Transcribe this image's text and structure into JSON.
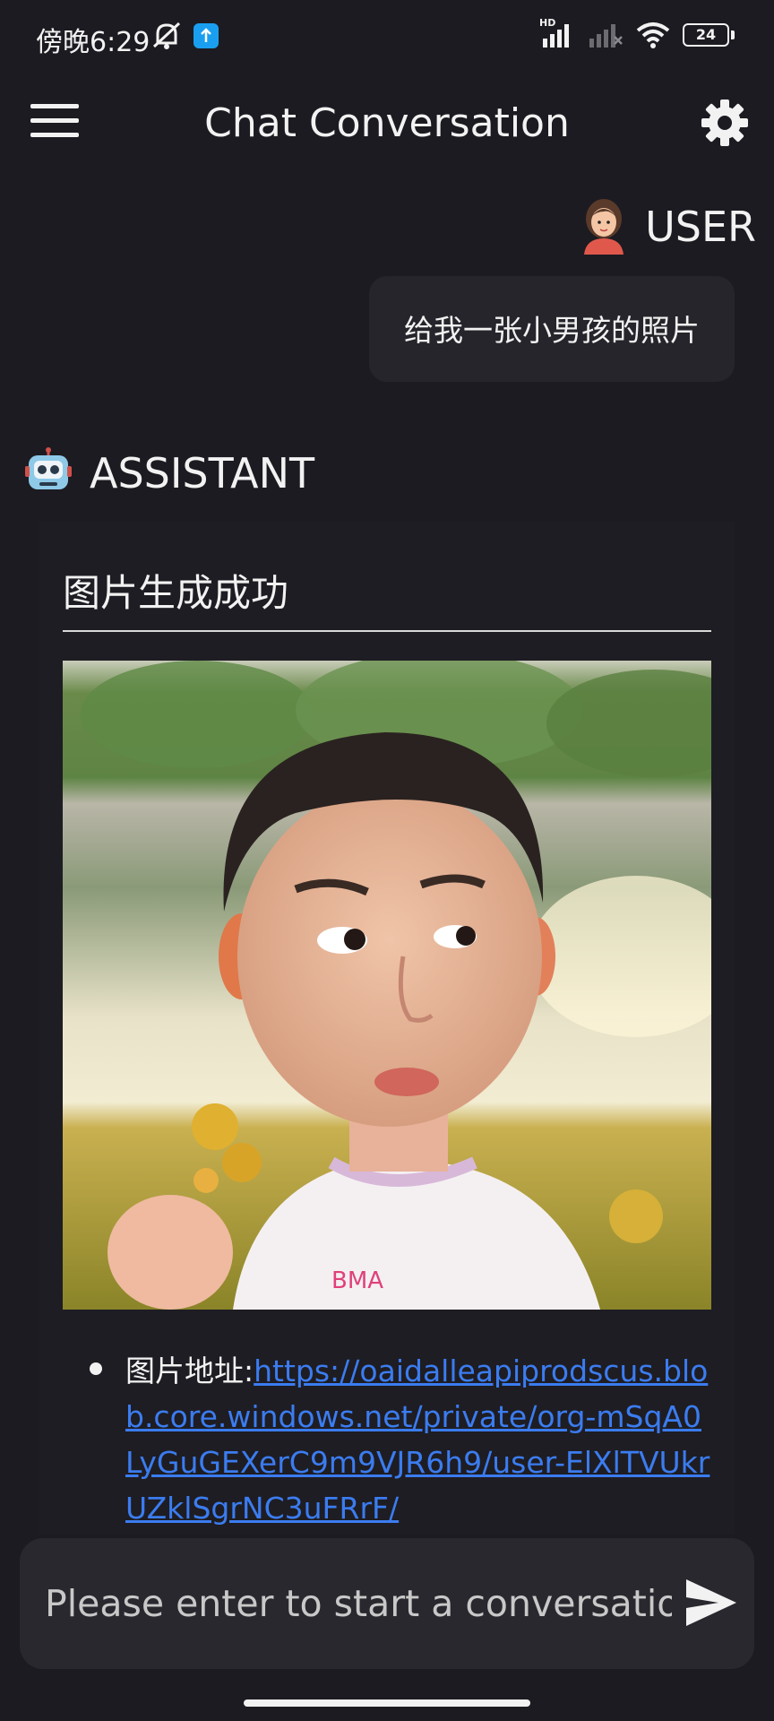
{
  "status_bar": {
    "time": "傍晚6:29",
    "network_label": "HD",
    "battery": "24"
  },
  "app_bar": {
    "title": "Chat Conversation",
    "menu_icon": "hamburger-menu-icon",
    "settings_icon": "gear-icon"
  },
  "conversation": {
    "user": {
      "role": "USER",
      "avatar_icon": "user-avatar-icon",
      "message": "给我一张小男孩的照片"
    },
    "assistant": {
      "role": "ASSISTANT",
      "avatar_icon": "robot-avatar-icon",
      "result_title": "图片生成成功",
      "image_alt": "generated photo of a young boy",
      "address_label": "图片地址:",
      "address_url": "https://oaidalleapiprodscus.blob.core.windows.net/private/org-mSqA0LyGuGEXerC9m9VJR6h9/user-ElXlTVUkrUZklSgrNC3uFRrF/"
    }
  },
  "composer": {
    "placeholder": "Please enter to start a conversation",
    "send_icon": "send-icon"
  },
  "colors": {
    "background": "#1c1b21",
    "bubble": "#26252b",
    "link": "#3b7cf0",
    "composer": "#29282e"
  }
}
